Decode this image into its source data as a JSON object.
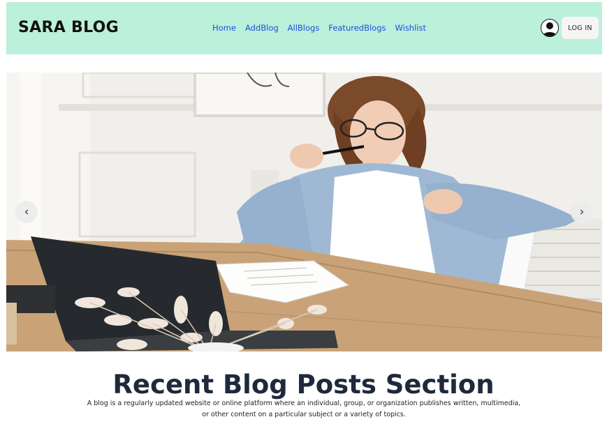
{
  "brand": {
    "name": "SARA BLOG"
  },
  "nav": {
    "links": [
      "Home",
      "AddBlog",
      "AllBlogs",
      "FeaturedBlogs",
      "Wishlist"
    ]
  },
  "header": {
    "login_label": "LOG IN"
  },
  "hero": {
    "prev_label": "‹",
    "next_label": "›"
  },
  "recent_section": {
    "title": "Recent Blog Posts Section",
    "description": "A blog is a regularly updated website or online platform where an individual, group, or organization publishes written, multimedia, or other content on a particular subject or a variety of topics."
  },
  "colors": {
    "navbar_bg": "#bbf0db",
    "link": "#1d4fd8",
    "title": "#1e2a3b"
  }
}
